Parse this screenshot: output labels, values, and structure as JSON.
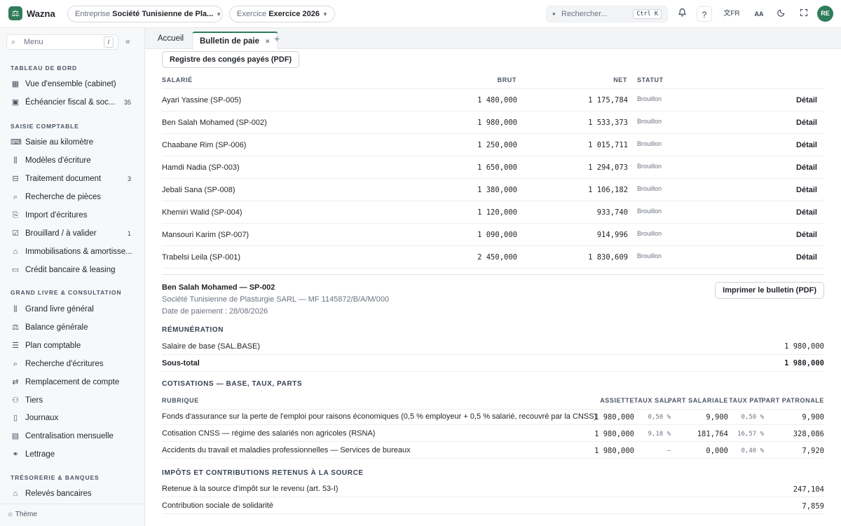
{
  "app": {
    "name": "Wazna",
    "logo_glyph": "⚖"
  },
  "topbar": {
    "entreprise_label": "Entreprise",
    "entreprise_value": "Société Tunisienne de Pla...",
    "exercice_label": "Exercice",
    "exercice_value": "Exercice 2026",
    "search_placeholder": "Rechercher...",
    "search_shortcut": "Ctrl K",
    "help": "?",
    "lang": "FR",
    "font_size": "AA",
    "user_initials": "RE"
  },
  "sidebar": {
    "menu_placeholder": "Menu",
    "menu_shortcut": "/",
    "sections": [
      {
        "title": "TABLEAU DE BORD",
        "items": [
          {
            "label": "Vue d'ensemble (cabinet)",
            "icon": "grid-icon",
            "badge": ""
          },
          {
            "label": "Échéancier fiscal & soc...",
            "icon": "calendar-icon",
            "badge": "35"
          }
        ]
      },
      {
        "title": "SAISIE COMPTABLE",
        "items": [
          {
            "label": "Saisie au kilomètre",
            "icon": "keyboard-icon",
            "badge": ""
          },
          {
            "label": "Modèles d'écriture",
            "icon": "books-icon",
            "badge": ""
          },
          {
            "label": "Traitement document",
            "icon": "scan-icon",
            "badge": "3"
          },
          {
            "label": "Recherche de pièces",
            "icon": "search-icon",
            "badge": ""
          },
          {
            "label": "Import d'écritures",
            "icon": "file-import-icon",
            "badge": ""
          },
          {
            "label": "Brouillard / à valider",
            "icon": "file-check-icon",
            "badge": "1"
          },
          {
            "label": "Immobilisations & amortisse...",
            "icon": "building-icon",
            "badge": ""
          },
          {
            "label": "Crédit bancaire & leasing",
            "icon": "card-icon",
            "badge": ""
          }
        ]
      },
      {
        "title": "GRAND LIVRE & CONSULTATION",
        "items": [
          {
            "label": "Grand livre général",
            "icon": "books-icon",
            "badge": ""
          },
          {
            "label": "Balance générale",
            "icon": "scale-icon",
            "badge": ""
          },
          {
            "label": "Plan comptable",
            "icon": "list-icon",
            "badge": ""
          },
          {
            "label": "Recherche d'écritures",
            "icon": "search-icon",
            "badge": ""
          },
          {
            "label": "Remplacement de compte",
            "icon": "swap-icon",
            "badge": ""
          },
          {
            "label": "Tiers",
            "icon": "users-icon",
            "badge": ""
          },
          {
            "label": "Journaux",
            "icon": "book-icon",
            "badge": ""
          },
          {
            "label": "Centralisation mensuelle",
            "icon": "document-icon",
            "badge": ""
          },
          {
            "label": "Lettrage",
            "icon": "link-icon",
            "badge": ""
          }
        ]
      },
      {
        "title": "TRÉSORERIE & BANQUES",
        "items": [
          {
            "label": "Relevés bancaires",
            "icon": "bank-icon",
            "badge": ""
          }
        ]
      }
    ],
    "theme_label": "Thème"
  },
  "tabs": {
    "items": [
      "Accueil",
      "Bulletin de paie"
    ],
    "active": "Bulletin de paie"
  },
  "main": {
    "registre_button": "Registre des congés payés (PDF)",
    "headers": {
      "salarie": "SALARIÉ",
      "brut": "BRUT",
      "net": "NET",
      "statut": "STATUT"
    },
    "employees": [
      {
        "name": "Ayari Yassine (SP-005)",
        "brut": "1 480,000",
        "net": "1 175,784",
        "status": "Brouillon",
        "action": "Détail"
      },
      {
        "name": "Ben Salah Mohamed (SP-002)",
        "brut": "1 980,000",
        "net": "1 533,373",
        "status": "Brouillon",
        "action": "Détail"
      },
      {
        "name": "Chaabane Rim (SP-006)",
        "brut": "1 250,000",
        "net": "1 015,711",
        "status": "Brouillon",
        "action": "Détail"
      },
      {
        "name": "Hamdi Nadia (SP-003)",
        "brut": "1 650,000",
        "net": "1 294,073",
        "status": "Brouillon",
        "action": "Détail"
      },
      {
        "name": "Jebali Sana (SP-008)",
        "brut": "1 380,000",
        "net": "1 106,182",
        "status": "Brouillon",
        "action": "Détail"
      },
      {
        "name": "Khemiri Walid (SP-004)",
        "brut": "1 120,000",
        "net": "933,740",
        "status": "Brouillon",
        "action": "Détail"
      },
      {
        "name": "Mansouri Karim (SP-007)",
        "brut": "1 090,000",
        "net": "914,996",
        "status": "Brouillon",
        "action": "Détail"
      },
      {
        "name": "Trabelsi Leila (SP-001)",
        "brut": "2 450,000",
        "net": "1 830,609",
        "status": "Brouillon",
        "action": "Détail"
      }
    ],
    "bulletin": {
      "title": "Ben Salah Mohamed — SP-002",
      "company": "Société Tunisienne de Plasturgie SARL — MF 1145872/B/A/M/000",
      "payment_date": "Date de paiement : 28/08/2026",
      "print_button": "Imprimer le bulletin (PDF)",
      "remuneration_title": "RÉMUNÉRATION",
      "salaire_label": "Salaire de base (SAL.BASE)",
      "salaire_value": "1 980,000",
      "subtotal_label": "Sous-total",
      "subtotal_value": "1 980,000",
      "cotisations_title": "COTISATIONS — BASE, TAUX, PARTS",
      "cot_headers": {
        "rubrique": "RUBRIQUE",
        "assiette": "ASSIETTE",
        "taux_sal": "TAUX SAL.",
        "part_sal": "PART SALARIALE",
        "taux_pat": "TAUX PAT.",
        "part_pat": "PART PATRONALE"
      },
      "cotisations": [
        {
          "rubrique": "Fonds d'assurance sur la perte de l'emploi pour raisons économiques (0,5 % employeur + 0,5 % salarié, recouvré par la CNSS)",
          "assiette": "1 980,000",
          "taux_sal": "0,50 %",
          "part_sal": "9,900",
          "taux_pat": "0,50 %",
          "part_pat": "9,900"
        },
        {
          "rubrique": "Cotisation CNSS — régime des salariés non agricoles (RSNA)",
          "assiette": "1 980,000",
          "taux_sal": "9,18 %",
          "part_sal": "181,764",
          "taux_pat": "16,57 %",
          "part_pat": "328,086"
        },
        {
          "rubrique": "Accidents du travail et maladies professionnelles — Services de bureaux",
          "assiette": "1 980,000",
          "taux_sal": "—",
          "part_sal": "0,000",
          "taux_pat": "0,40 %",
          "part_pat": "7,920"
        }
      ],
      "impots_title": "IMPÔTS ET CONTRIBUTIONS RETENUS À LA SOURCE",
      "impots": [
        {
          "label": "Retenue à la source d'impôt sur le revenu (art. 53-I)",
          "value": "247,104"
        },
        {
          "label": "Contribution sociale de solidarité",
          "value": "7,859"
        }
      ]
    }
  }
}
